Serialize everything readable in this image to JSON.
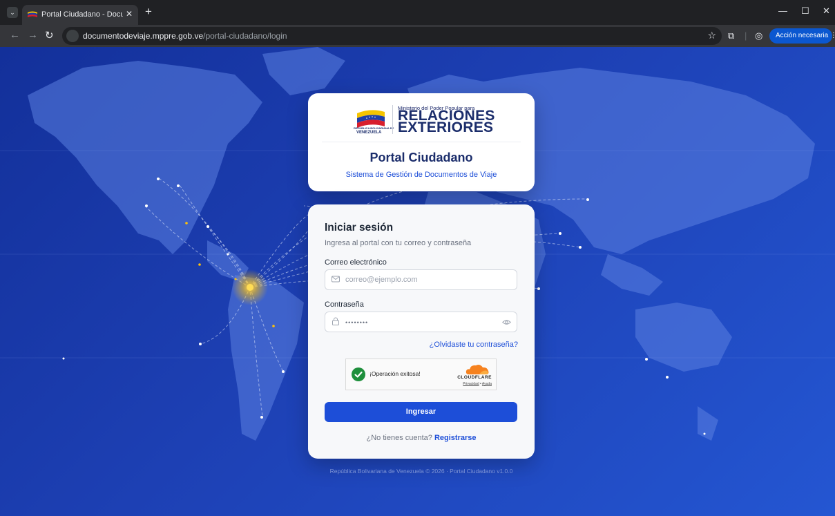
{
  "browser": {
    "tab_title": "Portal Ciudadano - Documento",
    "url_host": "documentodeviaje.mppre.gob.ve",
    "url_path": "/portal-ciudadano/login",
    "action_label": "Acción necesaria"
  },
  "header": {
    "ministerio_line": "Ministerio del Poder Popular para",
    "logo_line1": "RELACIONES",
    "logo_line2": "EXTERIORES",
    "republica_small": "REPÚBLICA BOLIVARIANA DE",
    "venezuela": "VENEZUELA",
    "portal_title": "Portal Ciudadano",
    "portal_subtitle": "Sistema de Gestión de Documentos de Viaje"
  },
  "login": {
    "title": "Iniciar sesión",
    "subtitle": "Ingresa al portal con tu correo y contraseña",
    "email_label": "Correo electrónico",
    "email_placeholder": "correo@ejemplo.com",
    "password_label": "Contraseña",
    "password_value": "••••••••",
    "forgot_link": "¿Olvidaste tu contraseña?",
    "submit_label": "Ingresar",
    "register_prompt": "¿No tienes cuenta?",
    "register_link": "Registrarse"
  },
  "captcha": {
    "status": "¡Operación exitosa!",
    "brand": "CLOUDFLARE",
    "privacy": "Privacidad",
    "separator": "•",
    "help": "Ayuda"
  },
  "footer": {
    "text": "República Bolivariana de Venezuela © 2026 · Portal Ciudadano v1.0.0"
  },
  "colors": {
    "primary": "#1d4ed8",
    "title_navy": "#1b2d6b",
    "background_blue": "#1d40b4",
    "captcha_success": "#1e8f3c",
    "hub_glow": "#ffc107"
  }
}
